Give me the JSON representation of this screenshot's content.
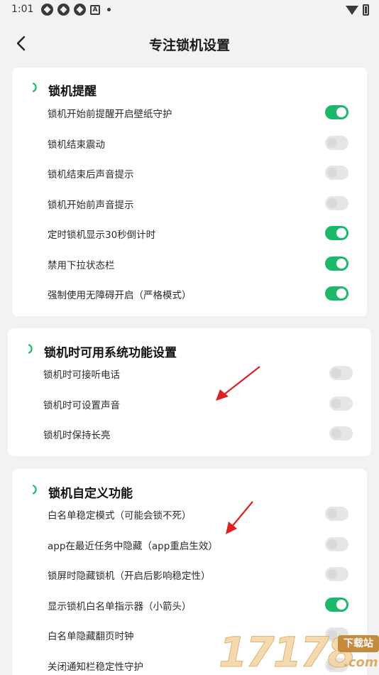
{
  "status_bar": {
    "time": "1:01",
    "notification_icons": [
      "app-icon",
      "app-icon",
      "app-icon",
      "a-icon",
      "dot-icon"
    ],
    "right_icons": [
      "wifi-icon",
      "battery-icon"
    ]
  },
  "app_bar": {
    "title": "专注锁机设置",
    "back_icon": "chevron-left-icon"
  },
  "accent_color": "#1db86a",
  "sections": [
    {
      "title": "锁机提醒",
      "items": [
        {
          "label": "锁机开始前提醒开启壁纸守护",
          "on": true
        },
        {
          "label": "锁机结束震动",
          "on": false
        },
        {
          "label": "锁机结束后声音提示",
          "on": false
        },
        {
          "label": "锁机开始前声音提示",
          "on": false
        },
        {
          "label": "定时锁机显示30秒倒计时",
          "on": true
        },
        {
          "label": "禁用下拉状态栏",
          "on": true
        },
        {
          "label": "强制使用无障碍开启（严格模式）",
          "on": true
        }
      ]
    },
    {
      "title": "锁机时可用系统功能设置",
      "items": [
        {
          "label": "锁机时可接听电话",
          "on": false
        },
        {
          "label": "锁机时可设置声音",
          "on": false
        },
        {
          "label": "锁机时保持长亮",
          "on": false
        }
      ]
    },
    {
      "title": "锁机自定义功能",
      "items": [
        {
          "label": "白名单稳定模式（可能会锁不死）",
          "on": false
        },
        {
          "label": "app在最近任务中隐藏（app重启生效）",
          "on": false
        },
        {
          "label": "锁屏时隐藏锁机（开启后影响稳定性）",
          "on": false
        },
        {
          "label": "显示锁机白名单指示器（小箭头）",
          "on": true
        },
        {
          "label": "白名单隐藏翻页时钟",
          "on": false
        },
        {
          "label": "关闭通知栏稳定性守护",
          "on": false
        }
      ]
    }
  ],
  "watermark": {
    "digits": "17178",
    "badge": "下载站",
    "domain": ".com"
  }
}
